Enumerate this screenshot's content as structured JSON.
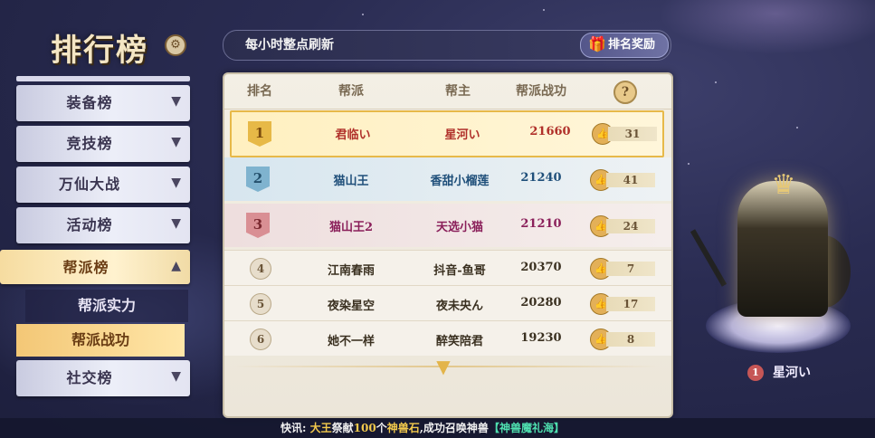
{
  "title": "排行榜",
  "refresh_text": "每小时整点刷新",
  "reward_button": "排名奖励",
  "sidebar": {
    "tabs": [
      {
        "label": "装备榜"
      },
      {
        "label": "竞技榜"
      },
      {
        "label": "万仙大战"
      },
      {
        "label": "活动榜"
      },
      {
        "label": "帮派榜"
      }
    ],
    "subtabs": [
      {
        "label": "帮派实力"
      },
      {
        "label": "帮派战功"
      }
    ],
    "last_tab": {
      "label": "社交榜"
    }
  },
  "table": {
    "headers": [
      "排名",
      "帮派",
      "帮主",
      "帮派战功"
    ],
    "help": "?",
    "rows": [
      {
        "rank": "1",
        "guild": "君临い",
        "leader": "星河い",
        "merit": "21660",
        "likes": "31"
      },
      {
        "rank": "2",
        "guild": "猫山王",
        "leader": "香甜小榴莲",
        "merit": "21240",
        "likes": "41"
      },
      {
        "rank": "3",
        "guild": "猫山王2",
        "leader": "天选小猫",
        "merit": "21210",
        "likes": "24"
      },
      {
        "rank": "4",
        "guild": "江南春雨",
        "leader": "抖音-鱼哥",
        "merit": "20370",
        "likes": "7"
      },
      {
        "rank": "5",
        "guild": "夜染星空",
        "leader": "夜未央ん",
        "merit": "20280",
        "likes": "17"
      },
      {
        "rank": "6",
        "guild": "她不一样",
        "leader": "醉笑陪君",
        "merit": "19230",
        "likes": "8"
      }
    ]
  },
  "character": {
    "rank": "1",
    "name": "星河い"
  },
  "ticker": {
    "prefix": "快讯:",
    "actor": "大王",
    "verb1": "祭献",
    "count": "100",
    "unit": "个",
    "item": "神兽石",
    "verb2": ",成功召唤神兽",
    "beast": "【神兽魔礼海】"
  },
  "colors": {
    "gold": "#e7b949",
    "silver_blue": "#7fb3cf",
    "bronze": "#d98f94"
  }
}
